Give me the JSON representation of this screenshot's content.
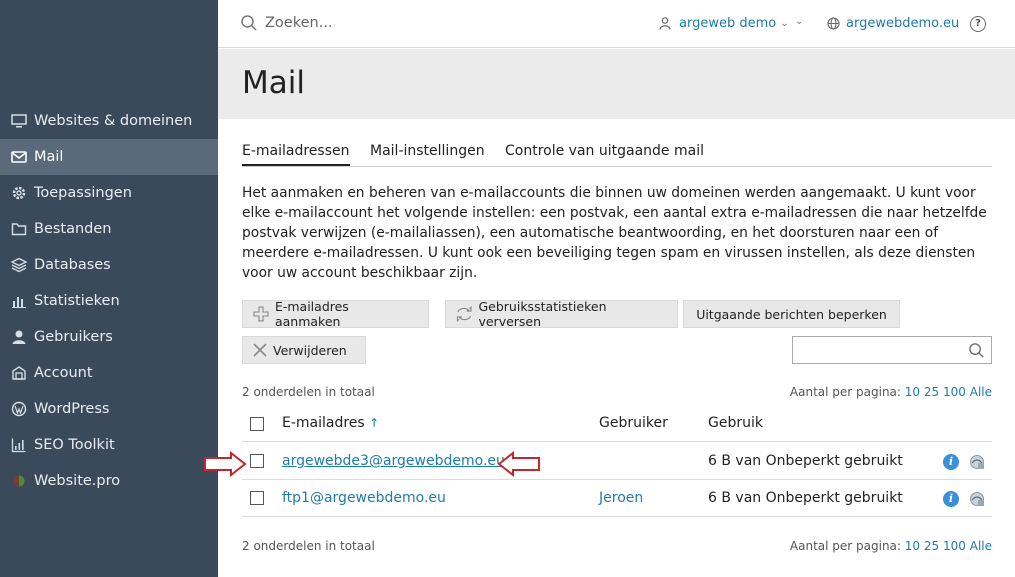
{
  "topbar": {
    "search_placeholder": "Zoeken...",
    "user": "argeweb demo",
    "domain": "argewebdemo.eu",
    "help": "?"
  },
  "sidebar": {
    "items": [
      {
        "label": "Websites & domeinen",
        "icon": "monitor-icon"
      },
      {
        "label": "Mail",
        "icon": "mail-icon",
        "active": true
      },
      {
        "label": "Toepassingen",
        "icon": "gear-icon"
      },
      {
        "label": "Bestanden",
        "icon": "folder-icon"
      },
      {
        "label": "Databases",
        "icon": "database-icon"
      },
      {
        "label": "Statistieken",
        "icon": "bar-chart-icon"
      },
      {
        "label": "Gebruikers",
        "icon": "user-icon"
      },
      {
        "label": "Account",
        "icon": "account-icon"
      },
      {
        "label": "WordPress",
        "icon": "wordpress-icon"
      },
      {
        "label": "SEO Toolkit",
        "icon": "seo-chart-icon"
      },
      {
        "label": "Website.pro",
        "icon": "websitepro-icon"
      }
    ]
  },
  "page": {
    "title": "Mail",
    "tabs": [
      "E-mailadressen",
      "Mail-instellingen",
      "Controle van uitgaande mail"
    ],
    "description": "Het aanmaken en beheren van e-mailaccounts die binnen uw domeinen werden aangemaakt. U kunt voor elke e-mailaccount het volgende instellen: een postvak, een aantal extra e-mailadressen die naar hetzelfde postvak verwijzen (e-mailaliassen), een automatische beantwoording, en het doorsturen naar een of meerdere e-mailadressen. U kunt ook een beveiliging tegen spam en virussen instellen, als deze diensten voor uw account beschikbaar zijn."
  },
  "toolbar": {
    "create": "E-mailadres aanmaken",
    "refresh": "Gebruiksstatistieken verversen",
    "limit": "Uitgaande berichten beperken",
    "delete": "Verwijderen"
  },
  "list": {
    "total_text": "2 onderdelen in totaal",
    "per_page_label": "Aantal per pagina:",
    "per_page_options": [
      "10",
      "25",
      "100",
      "Alle"
    ],
    "columns": {
      "email": "E-mailadres",
      "sort": "↑",
      "user": "Gebruiker",
      "usage": "Gebruik"
    },
    "rows": [
      {
        "email": "argewebde3@argewebdemo.eu",
        "user": "",
        "usage": "6 B van Onbeperkt gebruikt"
      },
      {
        "email": "ftp1@argewebdemo.eu",
        "user": "Jeroen",
        "usage": "6 B van Onbeperkt gebruikt"
      }
    ]
  },
  "colors": {
    "sidebar": "#3b4a5a",
    "link": "#1f7ba8",
    "arrow": "#c0282d"
  }
}
